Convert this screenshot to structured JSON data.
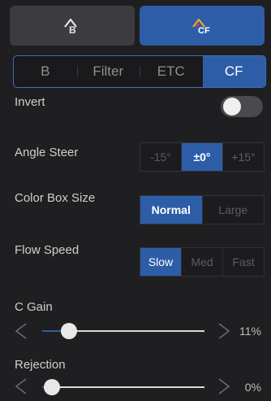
{
  "modes": [
    {
      "name": "B",
      "icon": "b-mode-icon",
      "active": false
    },
    {
      "name": "CF",
      "icon": "cf-mode-icon",
      "active": true
    }
  ],
  "tabs": [
    {
      "label": "B",
      "active": false
    },
    {
      "label": "Filter",
      "active": false
    },
    {
      "label": "ETC",
      "active": false
    },
    {
      "label": "CF",
      "active": true
    }
  ],
  "settings": {
    "invert": {
      "label": "Invert",
      "on": false
    },
    "angle_steer": {
      "label": "Angle Steer",
      "options": [
        "-15°",
        "±0°",
        "+15°"
      ],
      "selected": "±0°"
    },
    "color_box_size": {
      "label": "Color Box Size",
      "options": [
        "Normal",
        "Large"
      ],
      "selected": "Normal"
    },
    "flow_speed": {
      "label": "Flow Speed",
      "options": [
        "Slow",
        "Med",
        "Fast"
      ],
      "selected": "Slow"
    },
    "c_gain": {
      "label": "C Gain",
      "value": 11,
      "value_text": "11%"
    },
    "rejection": {
      "label": "Rejection",
      "value": 0,
      "value_text": "0%"
    }
  },
  "colors": {
    "accent": "#2e5da8",
    "background": "#1f1f21"
  }
}
